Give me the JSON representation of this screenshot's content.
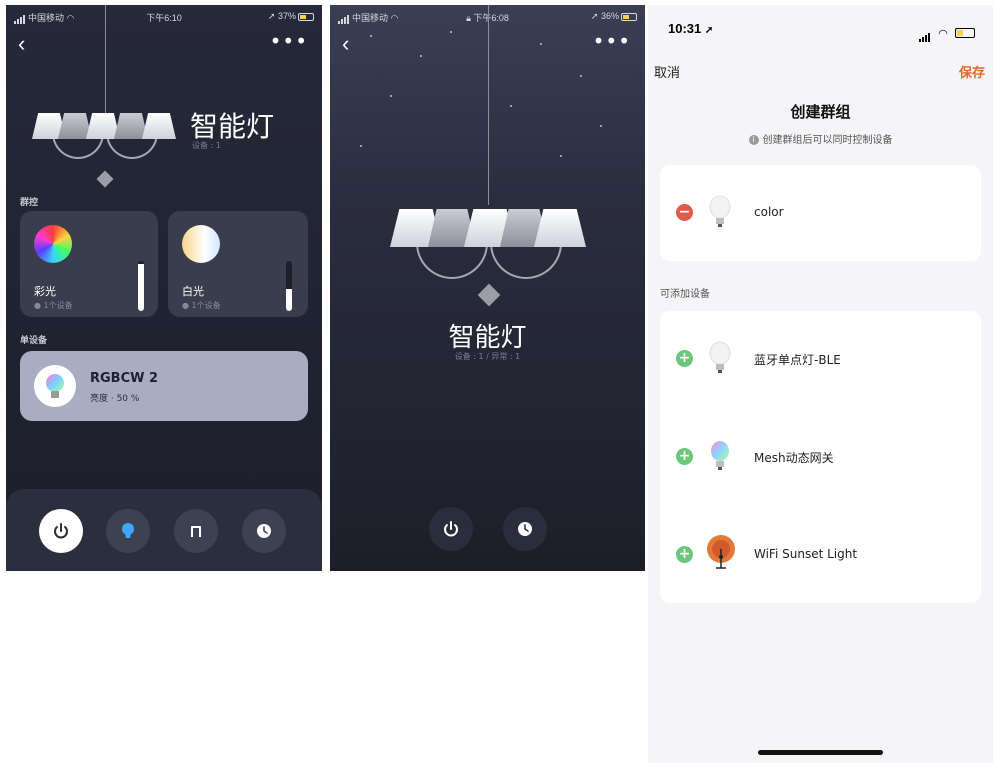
{
  "screen1": {
    "status": {
      "carrier": "中国移动",
      "time": "下午6:10",
      "battery": "37%"
    },
    "title": "智能灯",
    "device_count": "设备 : 1",
    "group_section": "群控",
    "cards": [
      {
        "name": "彩光",
        "sub": "1个设备",
        "level": 0.95
      },
      {
        "name": "白光",
        "sub": "1个设备",
        "level": 0.45
      }
    ],
    "single_section": "单设备",
    "device": {
      "name": "RGBCW 2",
      "brightness": "亮度 · 50 %"
    },
    "bottom_icons": [
      "power-icon",
      "bulb-icon",
      "music-icon",
      "clock-icon"
    ]
  },
  "screen2": {
    "status": {
      "carrier": "中国移动",
      "time": "下午6:08",
      "battery": "36%"
    },
    "title": "智能灯",
    "sub": "设备 : 1 / 异常 : 1",
    "bottom_icons": [
      "power-icon",
      "clock-icon"
    ]
  },
  "screen3": {
    "time": "10:31",
    "cancel": "取消",
    "save": "保存",
    "save_color": "#e8672b",
    "title": "创建群组",
    "hint": "创建群组后可以同时控制设备",
    "group_devices": [
      {
        "name": "color",
        "action": "remove"
      }
    ],
    "available_section": "可添加设备",
    "available_devices": [
      {
        "name": "蓝牙单点灯-BLE",
        "action": "add"
      },
      {
        "name": "Mesh动态网关",
        "action": "add"
      },
      {
        "name": "WiFi Sunset Light",
        "action": "add"
      }
    ]
  }
}
